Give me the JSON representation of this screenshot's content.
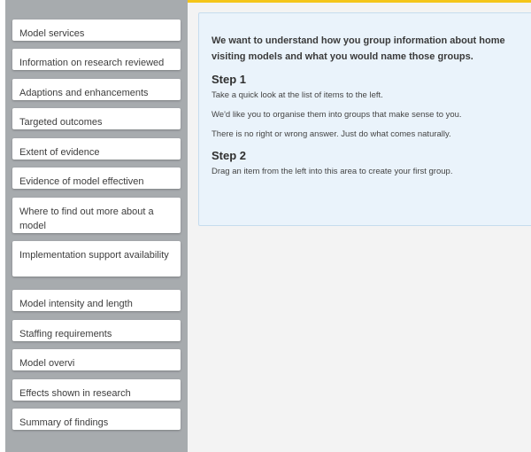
{
  "sidebar": {
    "items": [
      {
        "label": "Model services"
      },
      {
        "label": "Information on research reviewed"
      },
      {
        "label": "Adaptions and enhancements"
      },
      {
        "label": "Targeted outcomes"
      },
      {
        "label": "Extent of evidence"
      },
      {
        "label": "Evidence of model effectiven"
      },
      {
        "label": "Where to find out more about a model"
      },
      {
        "label": "Implementation support availability"
      },
      {
        "label": "Model intensity and length"
      },
      {
        "label": "Staffing requirements"
      },
      {
        "label": "Model overvi"
      },
      {
        "label": "Effects shown in research"
      },
      {
        "label": "Summary of findings"
      }
    ]
  },
  "dropzone": {
    "intro": "We want to understand how you group information about home visiting models and what you would name those groups.",
    "step1": {
      "title": "Step 1",
      "lines": [
        "Take a quick look at the list of items to the left.",
        "We'd like you to organise them into groups that make sense to you.",
        "There is no right or wrong answer. Just do what comes naturally."
      ]
    },
    "step2": {
      "title": "Step 2",
      "lines": [
        "Drag an item from the left into this area to create your first group."
      ]
    }
  },
  "colors": {
    "sidebar_bg": "#a7abae",
    "accent": "#f5c518",
    "dropzone_bg": "#eaf3fb",
    "dropzone_border": "#c6dcee"
  }
}
